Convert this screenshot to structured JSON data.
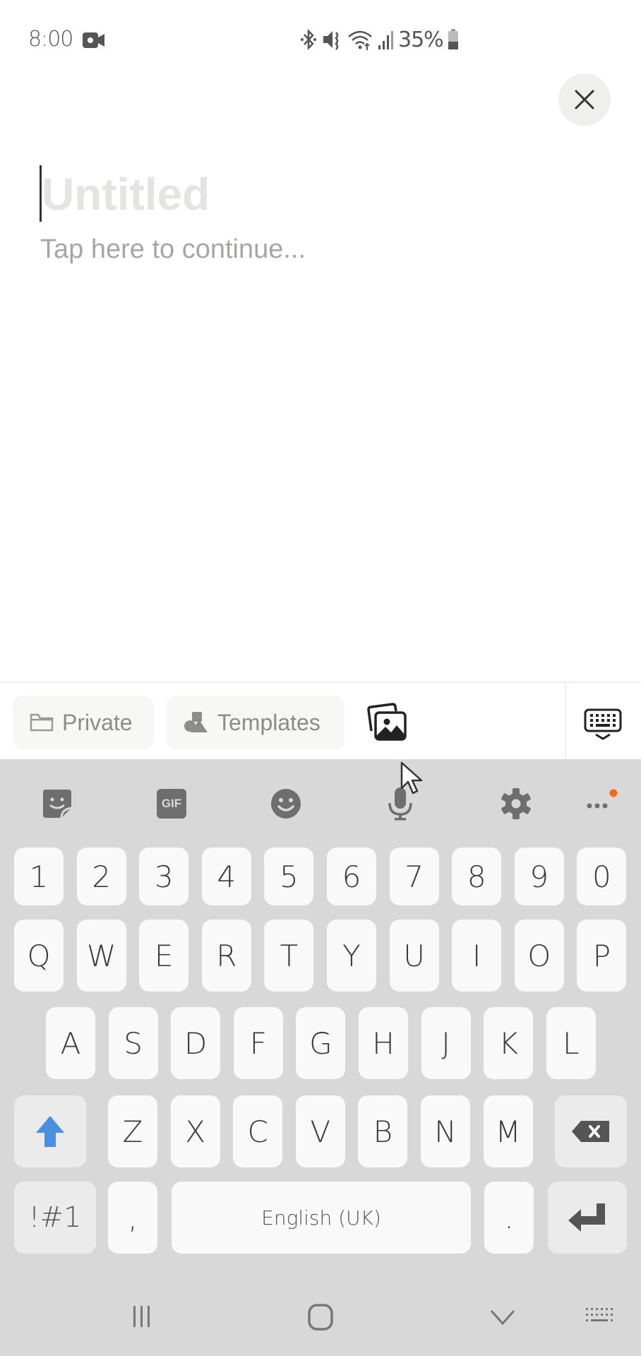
{
  "status_bar": {
    "time": "8:00",
    "battery_percent": "35%",
    "icons": [
      "screen-record-icon",
      "bluetooth-icon",
      "mute-icon",
      "wifi-icon",
      "signal-icon",
      "battery-icon"
    ]
  },
  "editor": {
    "title_placeholder": "Untitled",
    "body_placeholder": "Tap here to continue..."
  },
  "toolbar": {
    "private_label": "Private",
    "templates_label": "Templates"
  },
  "keyboard": {
    "tools": [
      "sticker-icon",
      "gif-icon",
      "emoji-icon",
      "microphone-icon",
      "settings-icon",
      "more-icon"
    ],
    "gif_label": "GIF",
    "number_row": [
      "1",
      "2",
      "3",
      "4",
      "5",
      "6",
      "7",
      "8",
      "9",
      "0"
    ],
    "row1": [
      "Q",
      "W",
      "E",
      "R",
      "T",
      "Y",
      "U",
      "I",
      "O",
      "P"
    ],
    "row2": [
      "A",
      "S",
      "D",
      "F",
      "G",
      "H",
      "J",
      "K",
      "L"
    ],
    "row3": [
      "Z",
      "X",
      "C",
      "V",
      "B",
      "N",
      "M"
    ],
    "symbols_label": "!#1",
    "comma": ",",
    "space_label": "English (UK)",
    "period": ".",
    "accent_color": "#4a90e2",
    "notification_dot_color": "#f26a1b"
  }
}
